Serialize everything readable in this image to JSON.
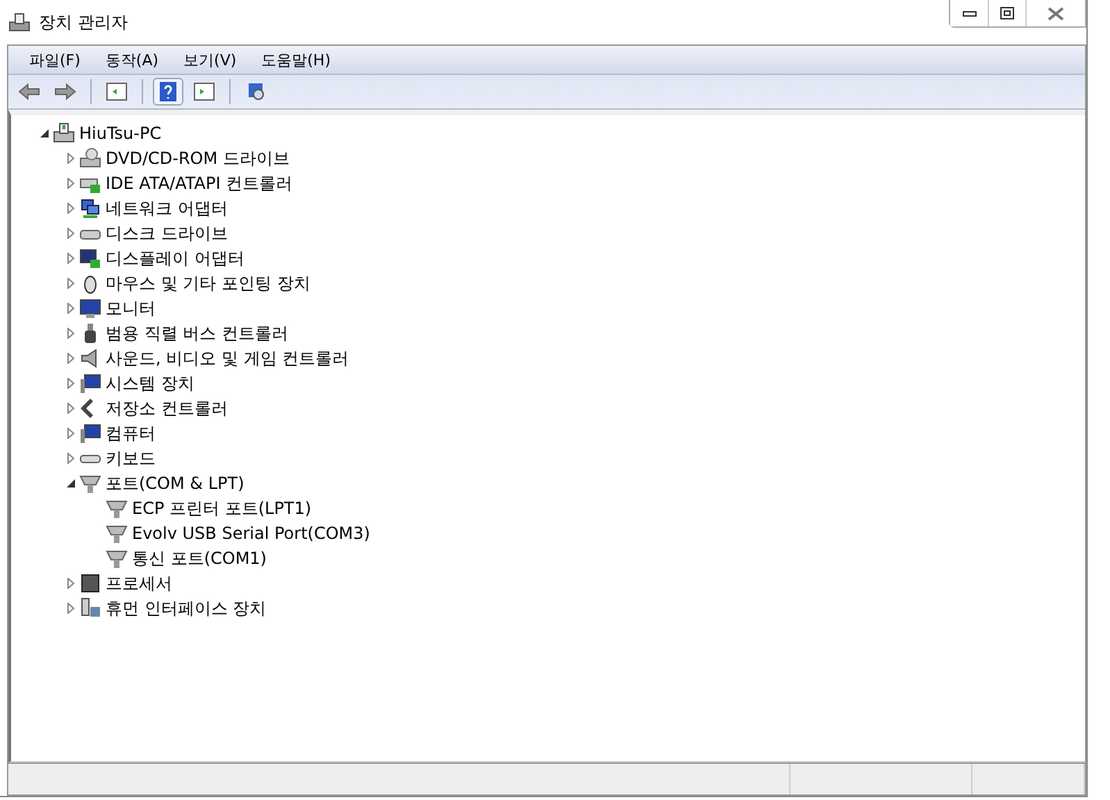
{
  "window": {
    "title": "장치 관리자"
  },
  "menu": [
    "파일(F)",
    "동작(A)",
    "보기(V)",
    "도움말(H)"
  ],
  "tree": {
    "label": "HiuTsu-PC",
    "expanded": true,
    "children": [
      {
        "label": "DVD/CD-ROM 드라이브",
        "expanded": false
      },
      {
        "label": "IDE ATA/ATAPI 컨트롤러",
        "expanded": false
      },
      {
        "label": "네트워크 어댑터",
        "expanded": false
      },
      {
        "label": "디스크 드라이브",
        "expanded": false
      },
      {
        "label": "디스플레이 어댑터",
        "expanded": false
      },
      {
        "label": "마우스 및 기타 포인팅 장치",
        "expanded": false
      },
      {
        "label": "모니터",
        "expanded": false
      },
      {
        "label": "범용 직렬 버스 컨트롤러",
        "expanded": false
      },
      {
        "label": "사운드, 비디오 및 게임 컨트롤러",
        "expanded": false
      },
      {
        "label": "시스템 장치",
        "expanded": false
      },
      {
        "label": "저장소 컨트롤러",
        "expanded": false
      },
      {
        "label": "컴퓨터",
        "expanded": false
      },
      {
        "label": "키보드",
        "expanded": false
      },
      {
        "label": "포트(COM & LPT)",
        "expanded": true,
        "children": [
          {
            "label": "ECP 프린터 포트(LPT1)"
          },
          {
            "label": "Evolv USB Serial Port(COM3)"
          },
          {
            "label": "통신 포트(COM1)"
          }
        ]
      },
      {
        "label": "프로세서",
        "expanded": false
      },
      {
        "label": "휴먼 인터페이스 장치",
        "expanded": false
      }
    ]
  }
}
